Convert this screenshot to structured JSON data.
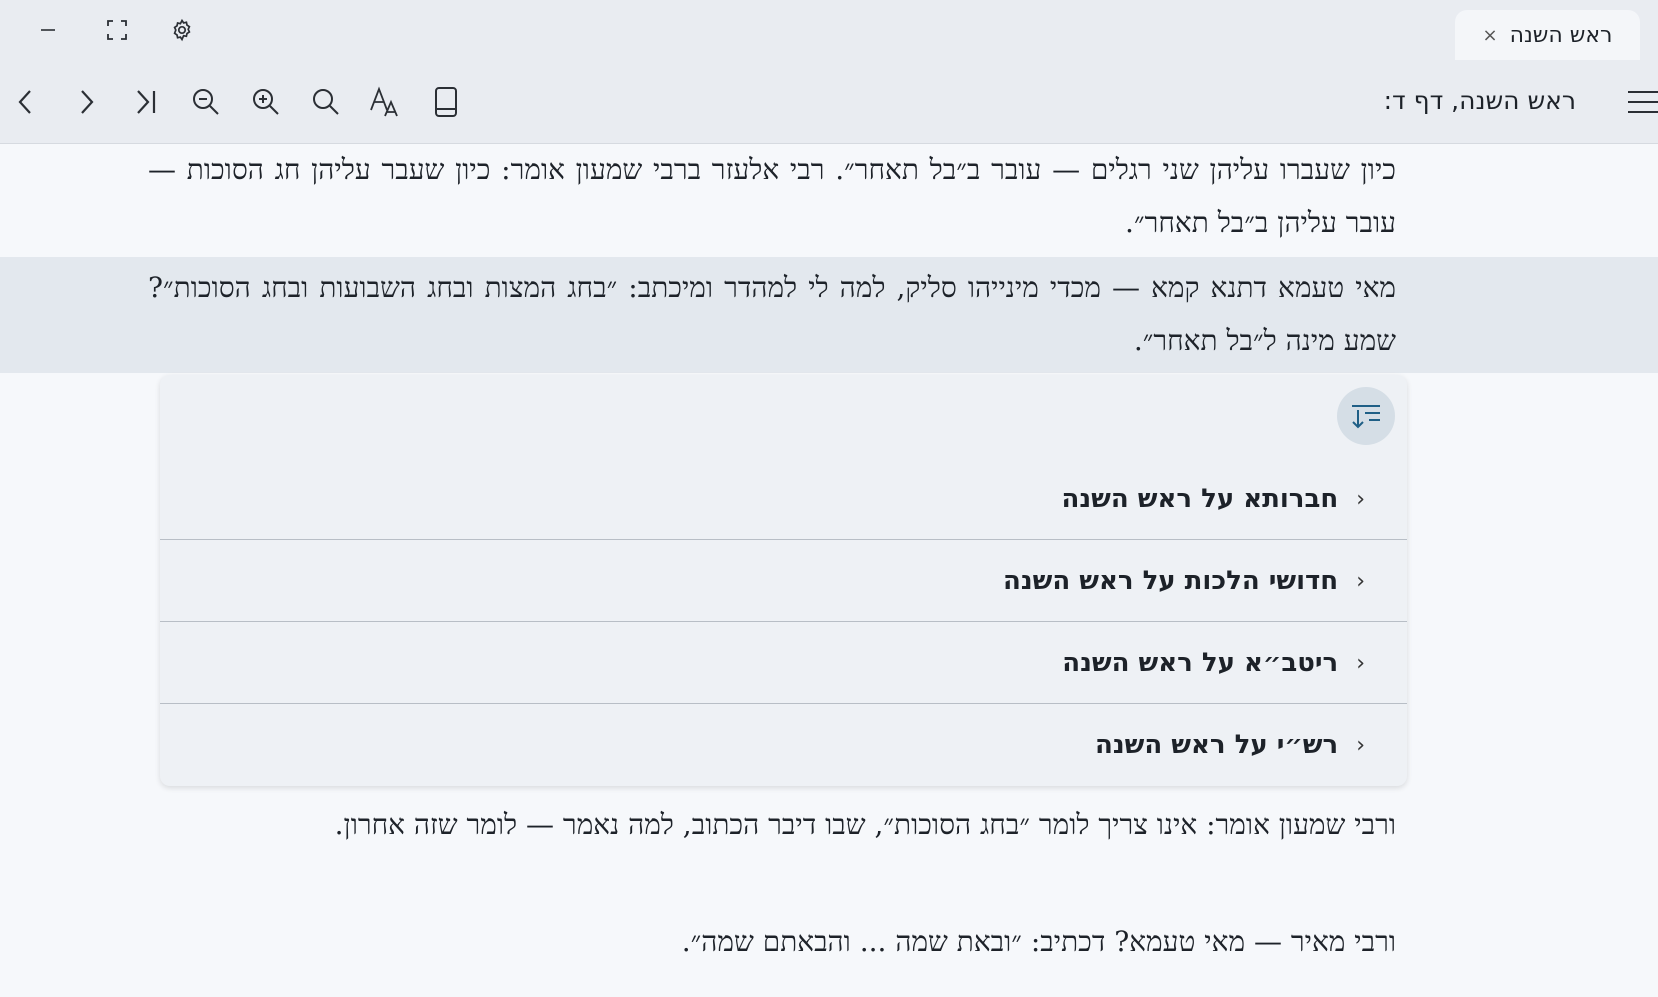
{
  "window": {
    "tab_title": "ראש השנה",
    "tab_close": "×"
  },
  "toolbar": {
    "location": "ראש השנה, דף ד:",
    "icons": [
      "back-icon",
      "forward-icon",
      "skip-to-end-icon",
      "zoom-out-icon",
      "zoom-in-icon",
      "search-icon",
      "font-size-icon",
      "book-icon",
      "menu-icon"
    ]
  },
  "content": {
    "para1": "כיון שעברו עליהן שני רגלים — עובר ב״בל תאחר״. רבי אלעזר ברבי שמעון אומר: כיון שעבר עליהן חג הסוכות — עובר עליהן ב״בל תאחר״.",
    "para2": "מאי טעמא דתנא קמא — מכדי מינייהו סליק, למה לי למהדר ומיכתב: ״בחג המצות ובחג השבועות ובחג הסוכות״? שמע מינה ל״בל תאחר״.",
    "commentaries": [
      {
        "label": "חברותא על ראש השנה"
      },
      {
        "label": "חדושי הלכות על ראש השנה"
      },
      {
        "label": "ריטב״א על ראש השנה"
      },
      {
        "label": "רש״י על ראש השנה"
      }
    ],
    "para3": "ורבי שמעון אומר: אינו צריך לומר ״בחג הסוכות״, שבו דיבר הכתוב, למה נאמר — לומר שזה אחרון.",
    "para4": "ורבי מאיר — מאי טעמא? דכתיב: ״ובאת שמה ... והבאתם שמה״."
  },
  "colors": {
    "chrome": "#e9ecf1",
    "page": "#f6f8fb",
    "highlight": "#e3e8ee",
    "accent": "#1f5f86"
  }
}
